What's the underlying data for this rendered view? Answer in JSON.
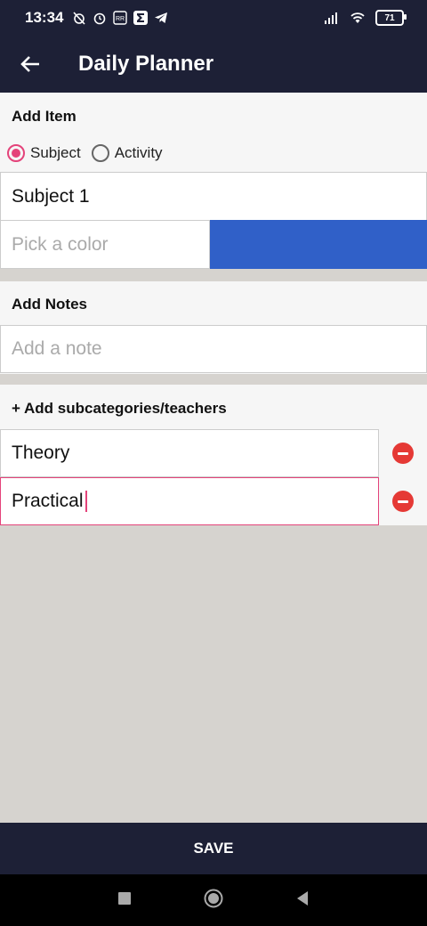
{
  "status_bar": {
    "time": "13:34",
    "battery": "71"
  },
  "app_bar": {
    "title": "Daily Planner"
  },
  "add_item": {
    "title": "Add Item",
    "radio_subject": "Subject",
    "radio_activity": "Activity",
    "name_value": "Subject 1",
    "color_placeholder": "Pick a color",
    "color_value": "#3060c8"
  },
  "add_notes": {
    "title": "Add Notes",
    "placeholder": "Add a note"
  },
  "subcategories": {
    "title": "+  Add subcategories/teachers",
    "items": [
      {
        "value": "Theory"
      },
      {
        "value": "Practical"
      }
    ]
  },
  "save_label": "SAVE",
  "colors": {
    "primary_dark": "#1d2036",
    "accent": "#e4437a",
    "remove": "#e53935"
  }
}
